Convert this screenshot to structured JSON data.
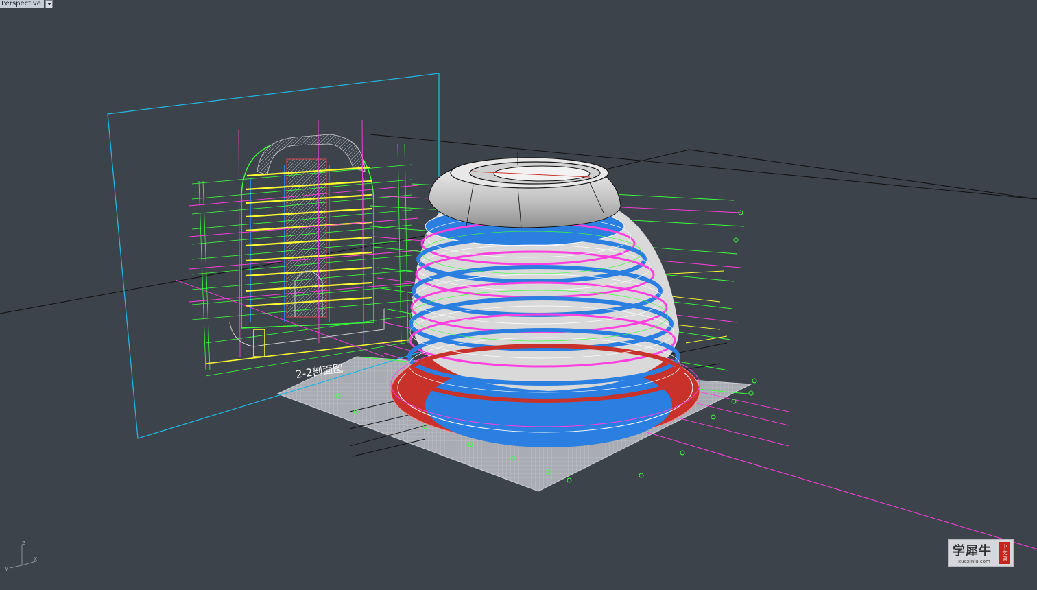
{
  "viewport": {
    "name": "Perspective"
  },
  "drawing": {
    "section_label": "2-2剖面图"
  },
  "axis_widget": {
    "z": "z",
    "x": "x",
    "y": "y"
  },
  "watermark": {
    "brand": "学犀牛",
    "url": "xuexinlu.com",
    "seal_top": "中",
    "seal_mid": "文",
    "seal_bot": "网"
  },
  "colors": {
    "background": "#3d434b",
    "cyan_plane": "#22b5e0",
    "magenta": "#ff3fe0",
    "green": "#3cff3c",
    "yellow": "#ffff33",
    "blue": "#2a7fe0",
    "red": "#c8322a",
    "shell_gray": "#d9d9d9"
  }
}
